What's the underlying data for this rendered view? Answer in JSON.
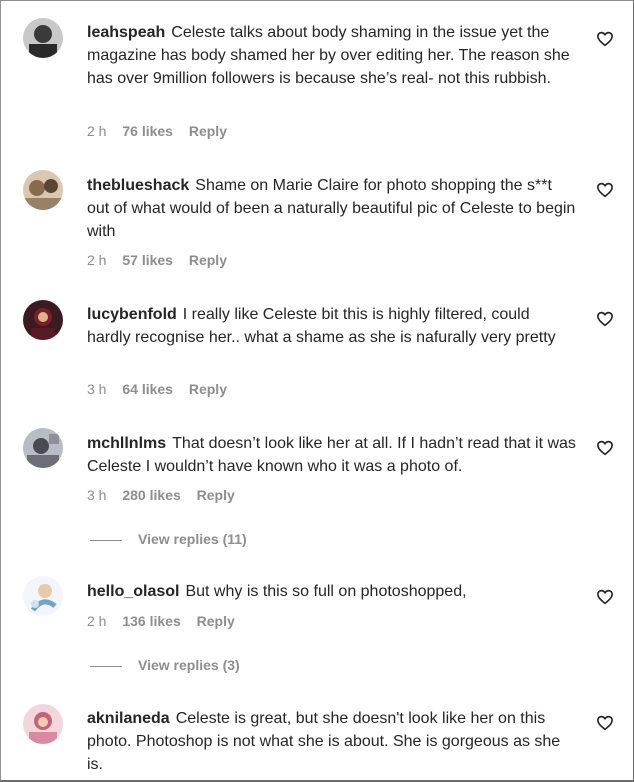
{
  "comments": [
    {
      "user": "leahspeah",
      "text": "Celeste talks about body shaming in the issue yet the magazine has body shamed her by over editing her. The reason she has over 9million followers is because she’s real- not this rubbish.",
      "time": "2 h",
      "likes": "76 likes",
      "reply": "Reply",
      "avatar_color": "#3a3a3a"
    },
    {
      "user": "theblueshack",
      "text": "Shame on Marie Claire for photo shopping the s**t out of what would of been a naturally beautiful pic of Celeste to begin with",
      "time": "2 h",
      "likes": "57 likes",
      "reply": "Reply",
      "avatar_color": "#8a6a4f"
    },
    {
      "user": "lucybenfold",
      "text": "I really like Celeste bit this is highly filtered, could hardly recognise her.. what a shame as she is nafurally very pretty",
      "time": "3 h",
      "likes": "64 likes",
      "reply": "Reply",
      "avatar_color": "#7a1f2b"
    },
    {
      "user": "mchllnlms",
      "text": "That doesn’t look like her at all. If I hadn’t read that it was Celeste I wouldn’t have known who it was a photo of.",
      "time": "3 h",
      "likes": "280 likes",
      "reply": "Reply",
      "avatar_color": "#4a4a52",
      "view_replies": "View replies (11)"
    },
    {
      "user": "hello_olasol",
      "text": "But why is this so full on photoshopped,",
      "time": "2 h",
      "likes": "136 likes",
      "reply": "Reply",
      "avatar_color": "#cfe3f1",
      "view_replies": "View replies (3)"
    },
    {
      "user": "aknilaneda",
      "text": "Celeste is great, but she doesn't look like her on this photo. Photoshop is not what she is about. She is gorgeous as she is.",
      "avatar_color": "#c4627a"
    }
  ]
}
